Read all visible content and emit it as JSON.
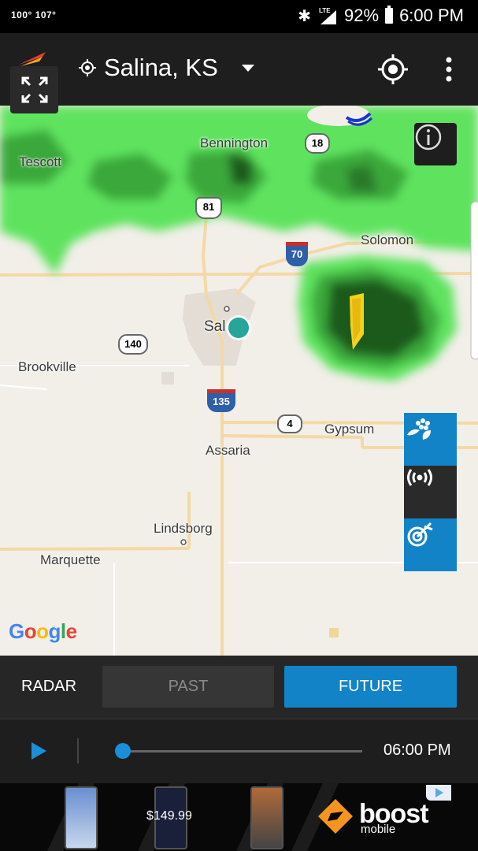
{
  "status_bar": {
    "temps": "100°  107°",
    "network": "LTE",
    "battery": "92%",
    "time": "6:00 PM"
  },
  "app_bar": {
    "location": "Salina, KS"
  },
  "map": {
    "labels": {
      "tescott": "Tescott",
      "bennington": "Bennington",
      "solomon": "Solomon",
      "salina": "Sal",
      "brookville": "Brookville",
      "gypsum": "Gypsum",
      "assaria": "Assaria",
      "lindsborg": "Lindsborg",
      "marquette": "Marquette"
    },
    "shields": {
      "us81": "81",
      "i70": "70",
      "k18": "18",
      "k140": "140",
      "i135": "135",
      "k4": "4"
    },
    "attribution": "Google"
  },
  "radar": {
    "label": "RADAR",
    "past": "PAST",
    "future": "FUTURE",
    "time": "06:00 PM",
    "progress": 0.0
  },
  "ad": {
    "price": "$149.99",
    "brand": "boost",
    "sub": "mobile"
  },
  "colors": {
    "accent": "#1383c7",
    "radar_light": "#5fe35f",
    "radar_dark": "#1e5a1e"
  }
}
